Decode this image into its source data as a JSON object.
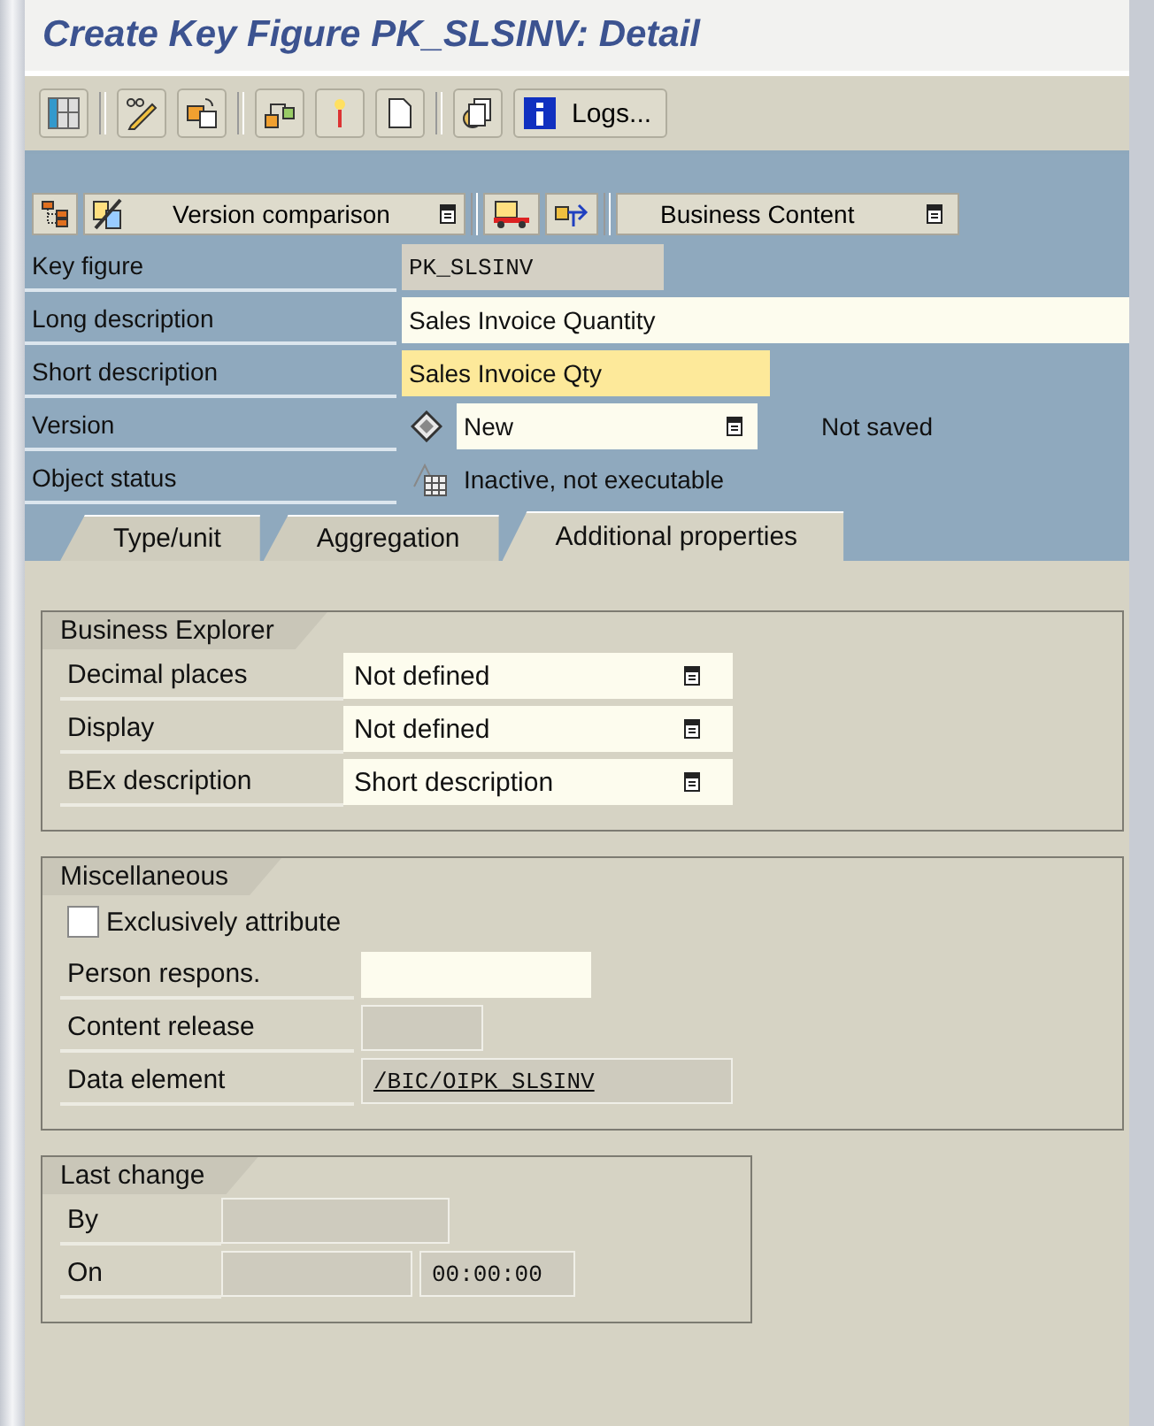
{
  "window": {
    "title": "Create Key Figure PK_SLSINV: Detail"
  },
  "toolbar": {
    "logs_button": "Logs..."
  },
  "app_toolbar": {
    "version_comparison": "Version comparison",
    "business_content": "Business Content"
  },
  "header_fields": [
    {
      "label": "Key figure",
      "kind": "readonly",
      "value": "PK_SLSINV"
    },
    {
      "label": "Long description",
      "kind": "input",
      "value": "Sales Invoice Quantity"
    },
    {
      "label": "Short description",
      "kind": "active_input",
      "value": "Sales Invoice Qty"
    },
    {
      "label": "Version",
      "kind": "dropdown",
      "value": "New",
      "note": "Not saved"
    },
    {
      "label": "Object status",
      "kind": "status",
      "value": "Inactive, not executable"
    }
  ],
  "tabs": [
    {
      "label": "Type/unit",
      "selected": false
    },
    {
      "label": "Aggregation",
      "selected": false
    },
    {
      "label": "Additional properties",
      "selected": true
    }
  ],
  "business_explorer": {
    "title": "Business Explorer",
    "fields": [
      {
        "label": "Decimal places",
        "kind": "dropdown",
        "value": "Not defined"
      },
      {
        "label": "Display",
        "kind": "dropdown",
        "value": "Not defined"
      },
      {
        "label": "BEx description",
        "kind": "dropdown",
        "value": "Short description"
      }
    ]
  },
  "miscellaneous": {
    "title": "Miscellaneous",
    "checkbox": {
      "label": "Exclusively attribute",
      "checked": false
    },
    "fields": [
      {
        "label": "Person respons.",
        "kind": "input"
      },
      {
        "label": "Content release",
        "kind": "readonly"
      },
      {
        "label": "Data element",
        "kind": "link",
        "value": "/BIC/OIPK_SLSINV"
      }
    ]
  },
  "last_change": {
    "title": "Last change",
    "fields": [
      {
        "label": "By",
        "kind": "readonly"
      },
      {
        "label": "On",
        "kind": "datetime",
        "time": "00:00:00"
      }
    ]
  }
}
